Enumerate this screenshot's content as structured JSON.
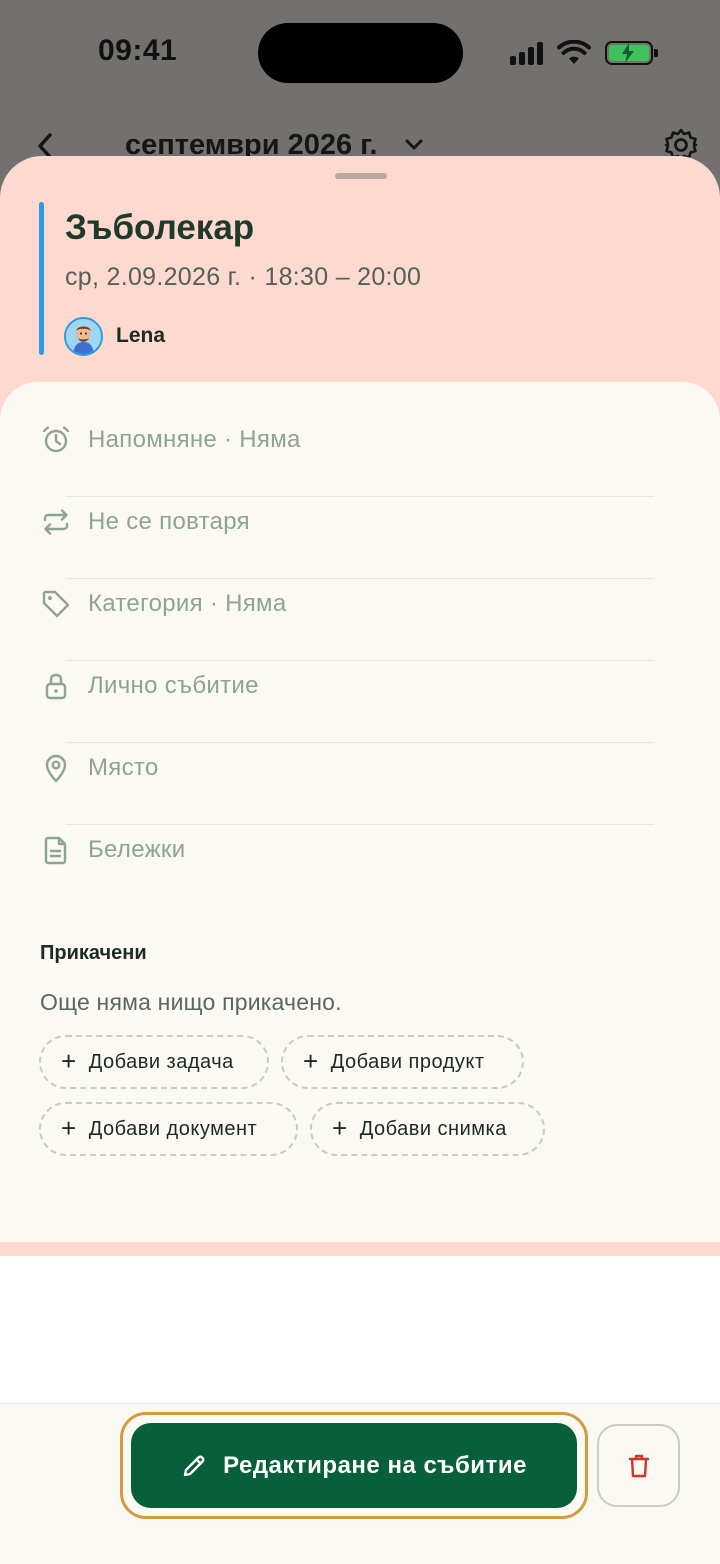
{
  "status_bar": {
    "time": "09:41"
  },
  "calendar_header": {
    "month_title": "септември 2026 г."
  },
  "event": {
    "title": "Зъболекар",
    "datetime": "ср, 2.09.2026 г. · 18:30 – 20:00",
    "owner": "Lena",
    "accent_color": "#2a9be4",
    "sheet_color": "#fdd9cf"
  },
  "details": [
    {
      "icon": "alarm-clock-icon",
      "label": "Напомняне · Няма"
    },
    {
      "icon": "repeat-icon",
      "label": "Не се повтаря"
    },
    {
      "icon": "tag-icon",
      "label": "Категория · Няма"
    },
    {
      "icon": "lock-icon",
      "label": "Лично събитие"
    },
    {
      "icon": "location-pin-icon",
      "label": "Място"
    },
    {
      "icon": "notes-icon",
      "label": "Бележки"
    }
  ],
  "attachments": {
    "title": "Прикачени",
    "empty_text": "Още няма нищо прикачено.",
    "actions": [
      "Добави задача",
      "Добави продукт",
      "Добави документ",
      "Добави снимка"
    ]
  },
  "actions": {
    "edit_label": "Редактиране на събитие",
    "primary_color": "#075f3c",
    "delete_color": "#d0342c"
  }
}
